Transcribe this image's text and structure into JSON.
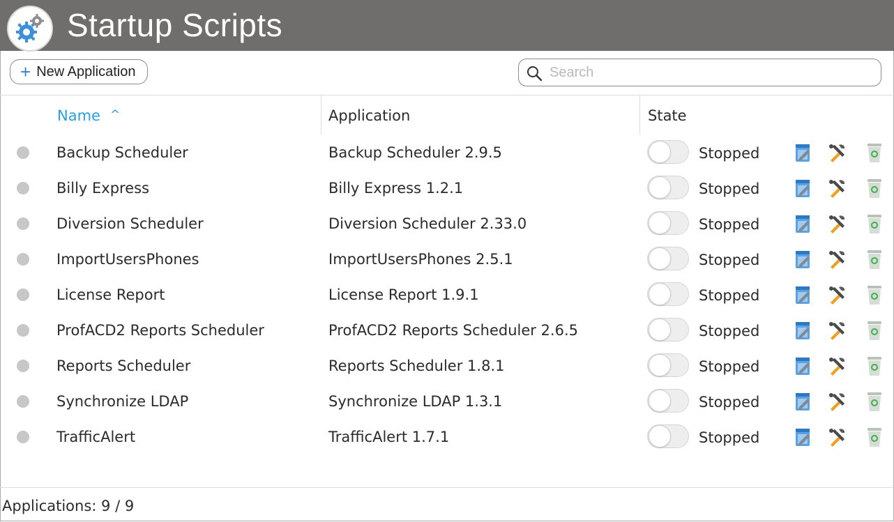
{
  "window": {
    "title": "Startup Scripts"
  },
  "toolbar": {
    "new_button_label": "New Application",
    "plus_glyph": "+"
  },
  "search": {
    "placeholder": "Search",
    "value": ""
  },
  "table": {
    "columns": {
      "name": "Name",
      "sort_indicator": "^",
      "application": "Application",
      "state": "State"
    },
    "rows": [
      {
        "name": "Backup Scheduler",
        "application": "Backup Scheduler 2.9.5",
        "state": "Stopped"
      },
      {
        "name": "Billy Express",
        "application": "Billy Express 1.2.1",
        "state": "Stopped"
      },
      {
        "name": "Diversion Scheduler",
        "application": "Diversion Scheduler 2.33.0",
        "state": "Stopped"
      },
      {
        "name": "ImportUsersPhones",
        "application": "ImportUsersPhones 2.5.1",
        "state": "Stopped"
      },
      {
        "name": "License Report",
        "application": "License Report 1.9.1",
        "state": "Stopped"
      },
      {
        "name": "ProfACD2 Reports Scheduler",
        "application": "ProfACD2 Reports Scheduler 2.6.5",
        "state": "Stopped"
      },
      {
        "name": "Reports Scheduler",
        "application": "Reports Scheduler 1.8.1",
        "state": "Stopped"
      },
      {
        "name": "Synchronize LDAP",
        "application": "Synchronize LDAP 1.3.1",
        "state": "Stopped"
      },
      {
        "name": "TrafficAlert",
        "application": "TrafficAlert 1.7.1",
        "state": "Stopped"
      }
    ]
  },
  "footer": {
    "count_label": "Applications: 9 / 9"
  },
  "colors": {
    "titlebar": "#6f6e6c",
    "accent": "#2a9fe0",
    "status_dot": "#c7c7c7"
  },
  "icons": {
    "logo": "gears-icon",
    "search": "search-icon",
    "edit": "edit-icon",
    "tools": "tools-icon",
    "delete": "trash-icon"
  }
}
